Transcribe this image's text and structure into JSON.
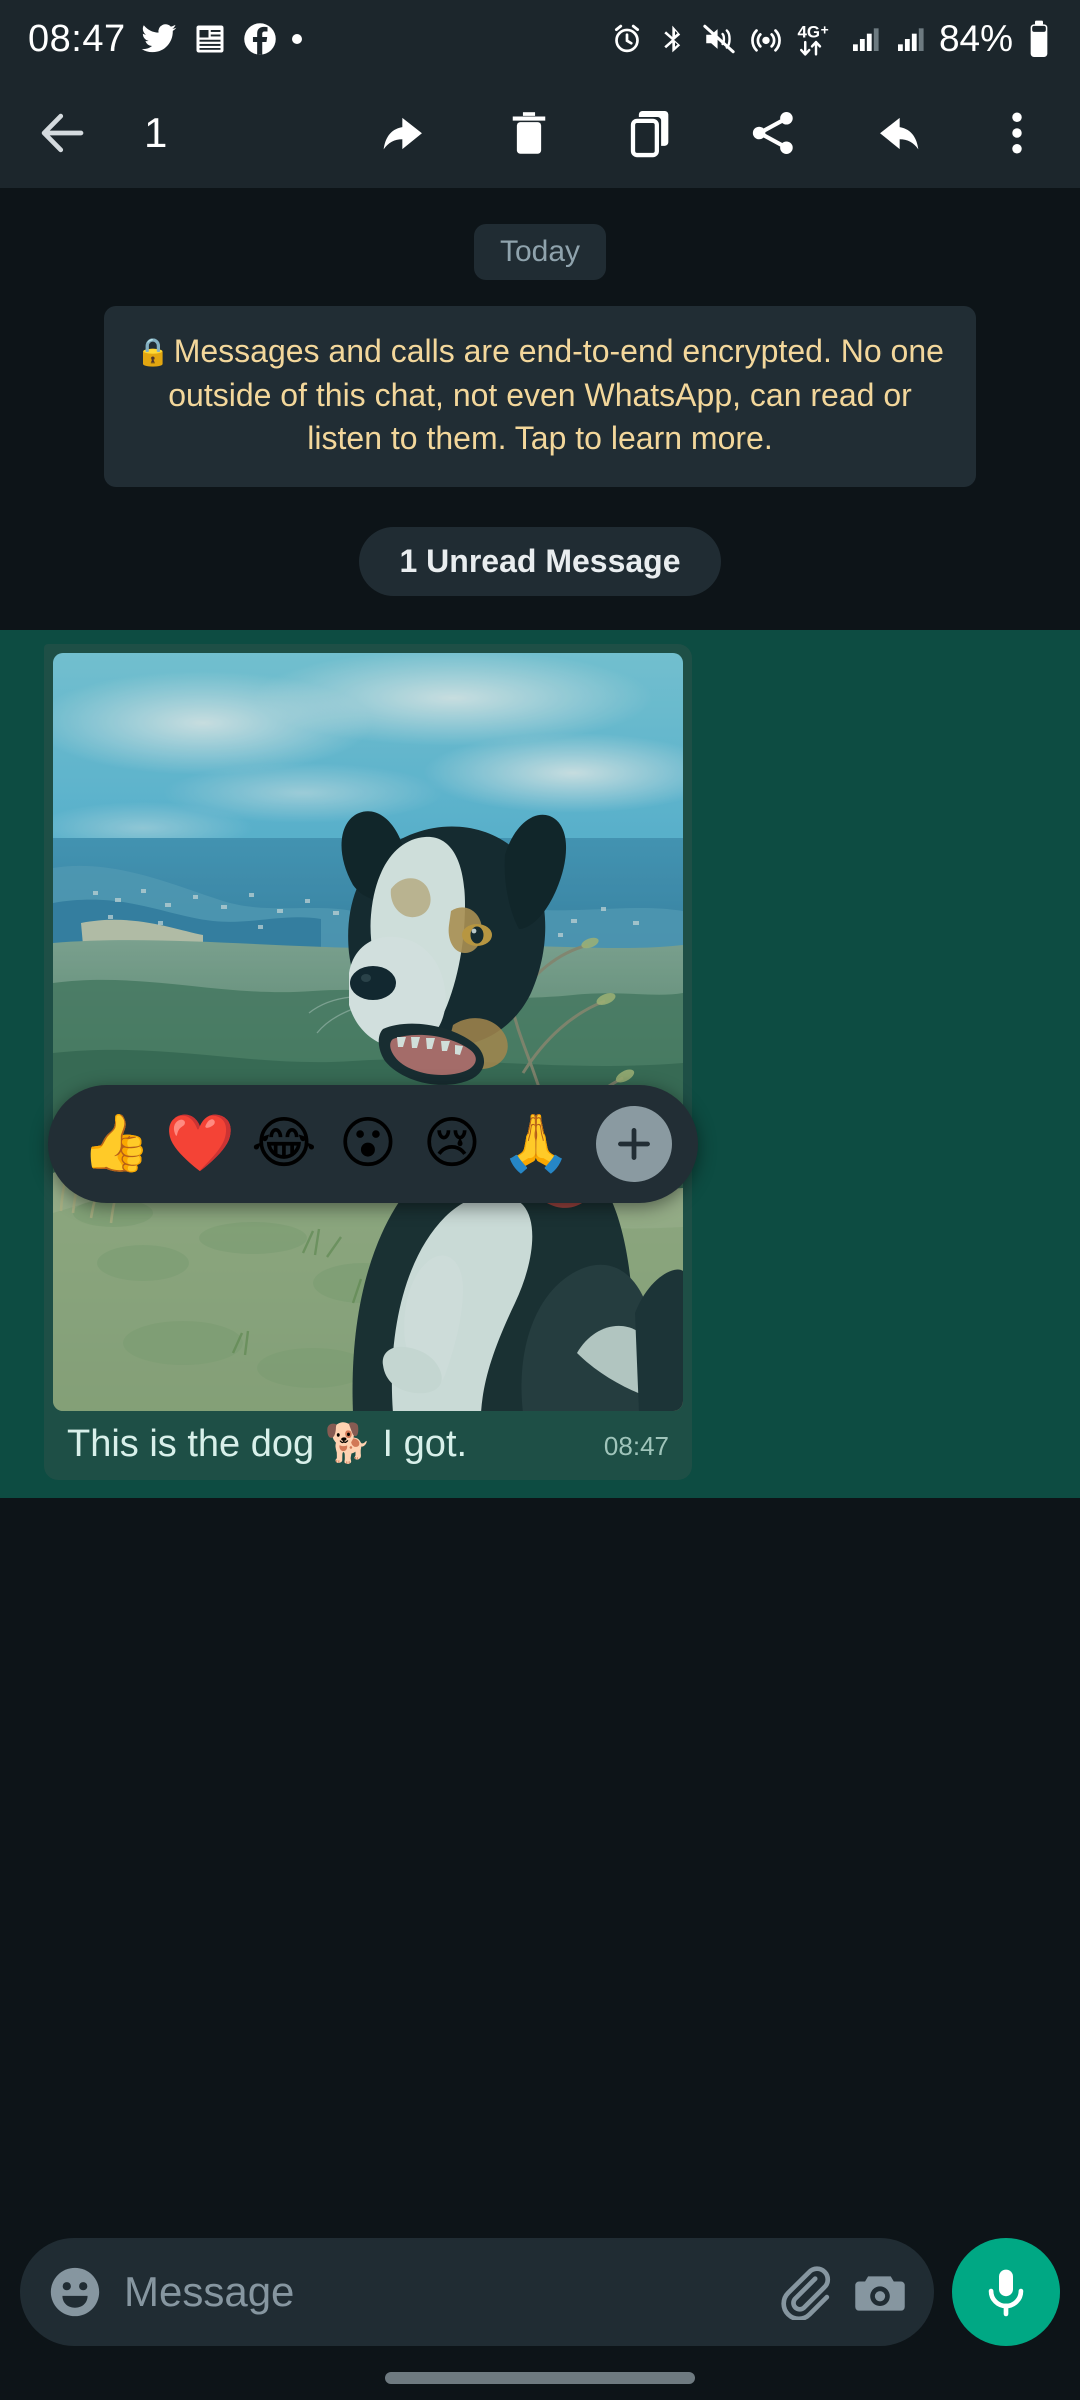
{
  "status_bar": {
    "time": "08:47",
    "battery_percent": "84%",
    "network_label": "4G+",
    "left_icons": [
      "twitter-icon",
      "news-icon",
      "facebook-icon",
      "dot-indicator-icon"
    ],
    "right_icons": [
      "alarm-icon",
      "bluetooth-icon",
      "vibrate-off-icon",
      "hotspot-icon",
      "mobile-data-4gplus-icon",
      "signal-bars-sim1-icon",
      "signal-bars-sim2-icon",
      "battery-icon"
    ],
    "background_color": "#1c262c"
  },
  "action_bar": {
    "selected_count": "1",
    "background_color": "#1c262c",
    "buttons": [
      {
        "name": "back-button",
        "icon": "arrow-left-icon"
      },
      {
        "name": "reply-button",
        "icon": "reply-arrow-icon"
      },
      {
        "name": "delete-button",
        "icon": "trash-icon"
      },
      {
        "name": "copy-button",
        "icon": "copy-icon"
      },
      {
        "name": "share-button",
        "icon": "share-nodes-icon"
      },
      {
        "name": "forward-button",
        "icon": "forward-arrow-icon"
      },
      {
        "name": "overflow-button",
        "icon": "dots-vertical-icon"
      }
    ]
  },
  "chat": {
    "day_divider": "Today",
    "encryption_notice": "Messages and calls are end-to-end encrypted. No one outside of this chat, not even WhatsApp, can read or listen to them. Tap to learn more.",
    "encryption_lock_icon": "lock-icon",
    "encryption_text_color": "#f3d79b",
    "unread_divider": "1 Unread Message",
    "selection_highlight_color": "#0d4c42",
    "background_color": "#0d1418",
    "message": {
      "caption": "This is the dog 🐕 I got.",
      "time": "08:47",
      "bubble_color": "#1e4f46",
      "attachment": "photo-of-dog-on-hilltop-overlooking-bay",
      "selected": true
    }
  },
  "reaction_bar": {
    "background_color": "#222e35",
    "emojis": [
      "👍",
      "❤️",
      "😂",
      "😮",
      "😢",
      "🙏"
    ],
    "more_button_icon": "plus-icon"
  },
  "input_bar": {
    "placeholder": "Message",
    "value": "",
    "emoji_icon": "emoji-smiley-icon",
    "attach_icon": "paperclip-icon",
    "camera_icon": "camera-icon",
    "mic_icon": "microphone-icon",
    "mic_button_color": "#00a884",
    "field_color": "#202c33"
  }
}
